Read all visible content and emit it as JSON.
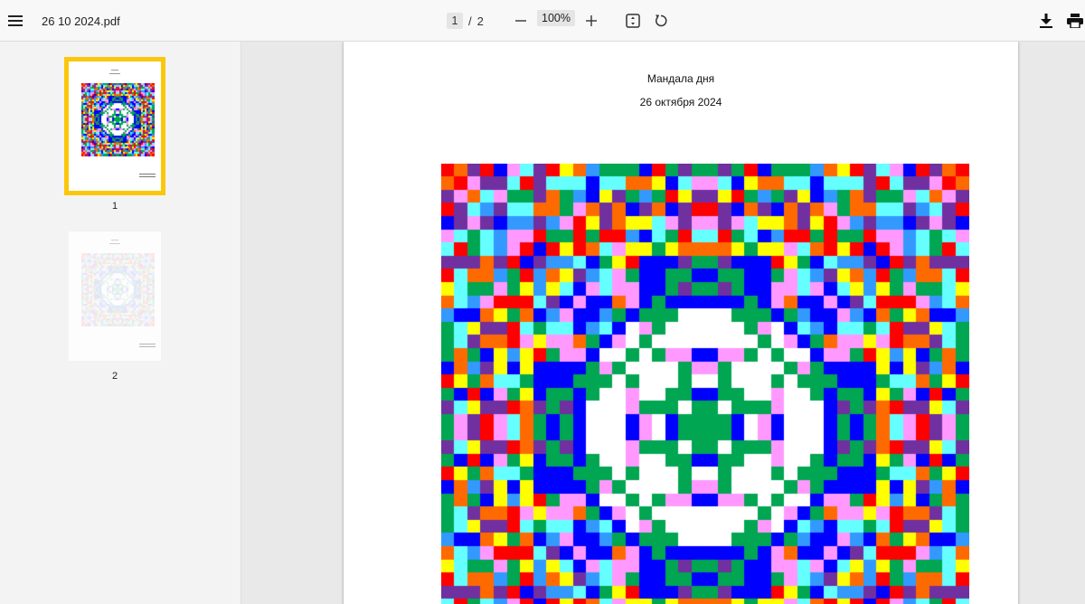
{
  "toolbar": {
    "file_name": "26 10 2024.pdf",
    "current_page": "1",
    "page_separator": "/",
    "total_pages": "2",
    "zoom": "100%"
  },
  "sidebar": {
    "thumbnails": [
      {
        "label": "1",
        "selected": true
      },
      {
        "label": "2",
        "selected": false
      }
    ],
    "selected_color": "#fbc70b"
  },
  "document": {
    "title": "Мандала дня",
    "date": "26 октября 2024"
  },
  "mandala": {
    "palette": [
      "#ff0000",
      "#ff6a00",
      "#ffff00",
      "#00a651",
      "#66ffff",
      "#3399ff",
      "#0000ff",
      "#7030a0",
      "#ff99ff",
      "#ffffff"
    ],
    "grid_size": 40
  },
  "icons": [
    "menu-icon",
    "zoom-out-icon",
    "zoom-in-icon",
    "fit-page-icon",
    "rotate-icon",
    "download-icon",
    "print-icon"
  ]
}
